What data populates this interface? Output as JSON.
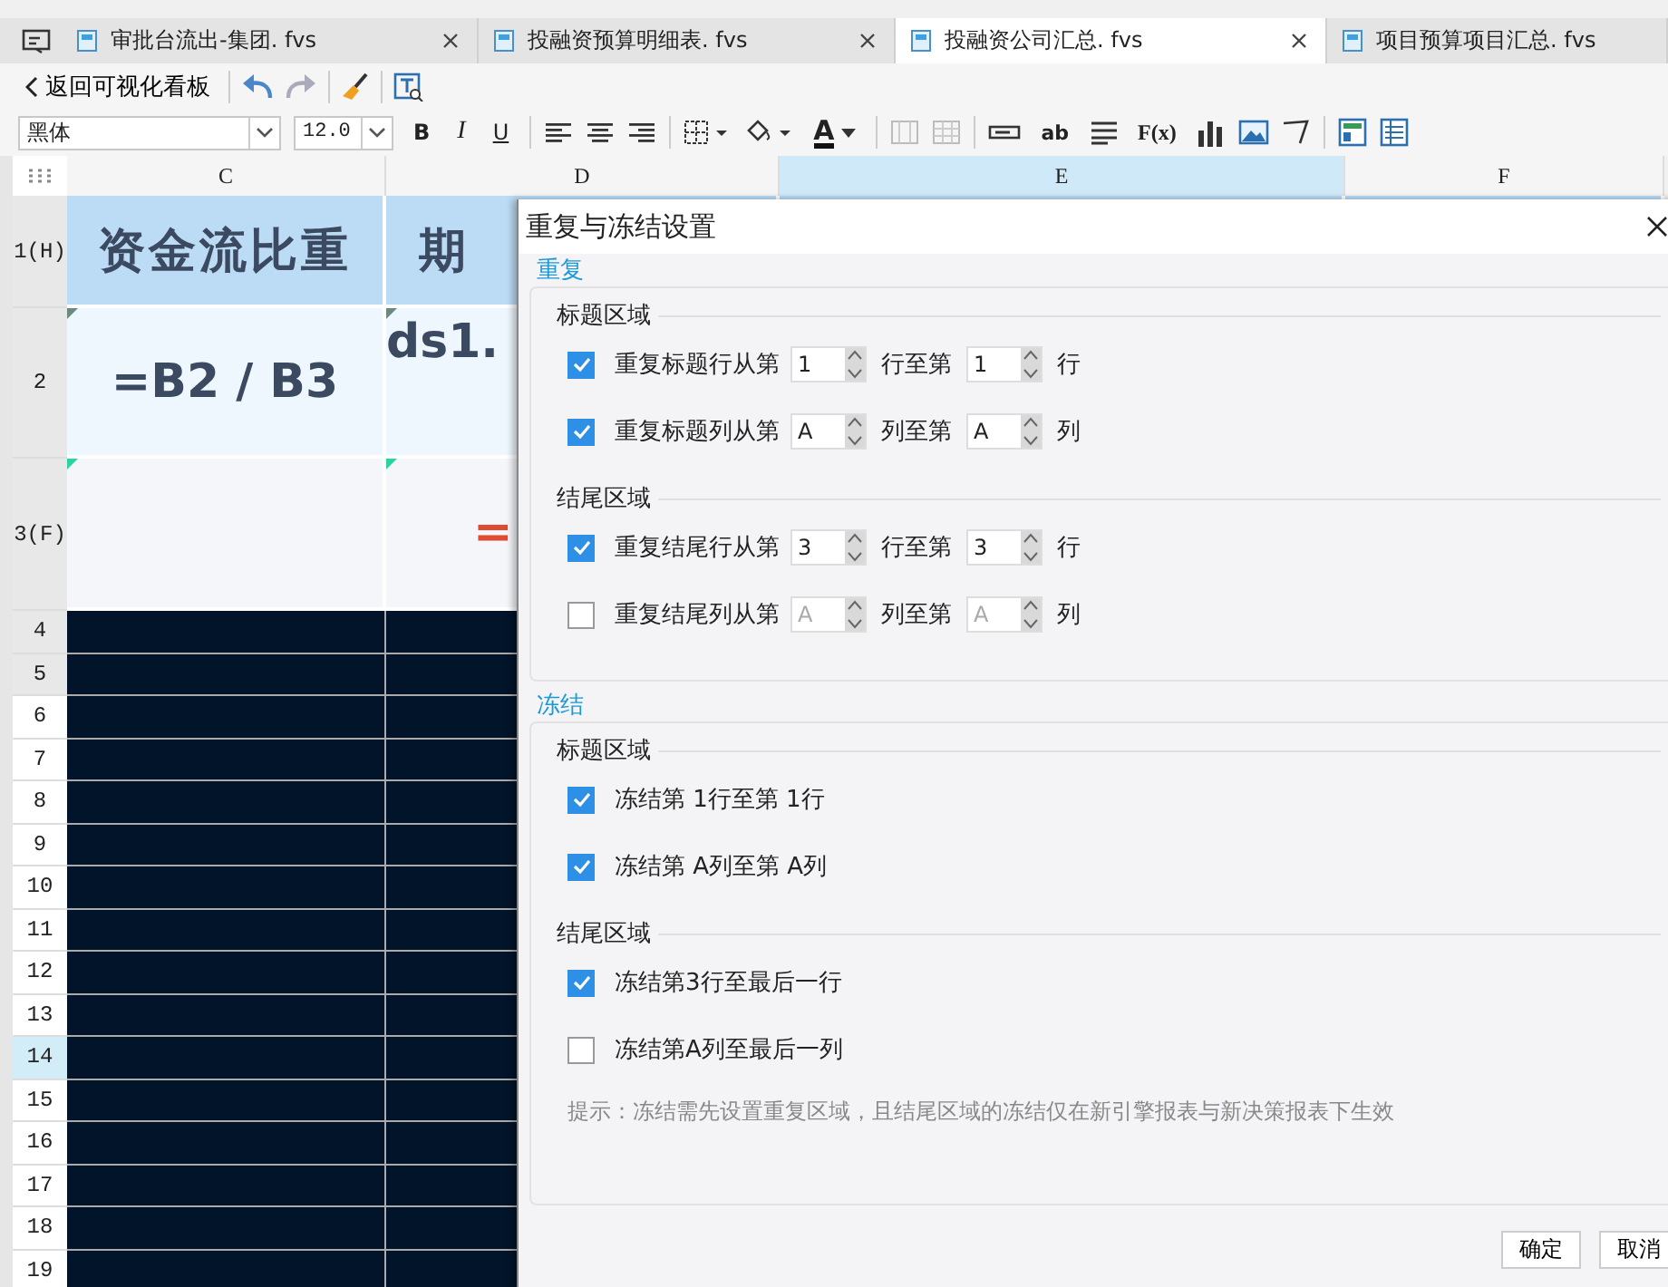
{
  "tabs": [
    {
      "label": "审批台流出-集团. fvs",
      "selected": false,
      "closable": true
    },
    {
      "label": "投融资预算明细表. fvs",
      "selected": false,
      "closable": true
    },
    {
      "label": "投融资公司汇总. fvs",
      "selected": true,
      "closable": true
    },
    {
      "label": "项目预算项目汇总. fvs",
      "selected": false,
      "closable": false
    }
  ],
  "toolbar": {
    "back": "返回可视化看板"
  },
  "format_bar": {
    "font": "黑体",
    "size": "12.0",
    "bold": "B",
    "italic": "I",
    "underline": "U",
    "font_color": "A",
    "text_widget": "ab",
    "formula": "F(x)"
  },
  "columns": [
    {
      "label": "C",
      "selected": false
    },
    {
      "label": "D",
      "selected": false
    },
    {
      "label": "E",
      "selected": true
    },
    {
      "label": "F",
      "selected": false
    }
  ],
  "rows": [
    {
      "label": "1(H)",
      "kind": "header",
      "frozen": true,
      "selected": false,
      "cells": [
        "资金流比重",
        "期"
      ]
    },
    {
      "label": "2",
      "kind": "formula",
      "frozen": true,
      "selected": false,
      "cells": [
        "=B2 / B3",
        "ds1."
      ]
    },
    {
      "label": "3(F)",
      "kind": "footer",
      "frozen": true,
      "selected": false,
      "cells": [
        "",
        "="
      ]
    },
    {
      "label": "4",
      "kind": "empty",
      "frozen": true,
      "selected": false
    },
    {
      "label": "5",
      "kind": "empty",
      "frozen": true,
      "selected": false
    },
    {
      "label": "6",
      "kind": "empty",
      "frozen": false,
      "selected": false
    },
    {
      "label": "7",
      "kind": "empty",
      "frozen": false,
      "selected": false
    },
    {
      "label": "8",
      "kind": "empty",
      "frozen": false,
      "selected": false
    },
    {
      "label": "9",
      "kind": "empty",
      "frozen": false,
      "selected": false
    },
    {
      "label": "10",
      "kind": "empty",
      "frozen": false,
      "selected": false
    },
    {
      "label": "11",
      "kind": "empty",
      "frozen": false,
      "selected": false
    },
    {
      "label": "12",
      "kind": "empty",
      "frozen": false,
      "selected": false
    },
    {
      "label": "13",
      "kind": "empty",
      "frozen": false,
      "selected": false
    },
    {
      "label": "14",
      "kind": "empty",
      "frozen": false,
      "selected": true
    },
    {
      "label": "15",
      "kind": "empty",
      "frozen": false,
      "selected": false
    },
    {
      "label": "16",
      "kind": "empty",
      "frozen": false,
      "selected": false
    },
    {
      "label": "17",
      "kind": "empty",
      "frozen": false,
      "selected": false
    },
    {
      "label": "18",
      "kind": "empty",
      "frozen": false,
      "selected": false
    },
    {
      "label": "19",
      "kind": "empty",
      "frozen": false,
      "selected": false
    }
  ],
  "dialog": {
    "title": "重复与冻结设置",
    "sections": [
      {
        "title": "重复",
        "groups": [
          {
            "title": "标题区域",
            "rows": [
              {
                "kind": "range",
                "checked": true,
                "disabled": false,
                "label": "重复标题行从第",
                "from": "1",
                "middle": "行至第",
                "to": "1",
                "suffix": "行"
              },
              {
                "kind": "range",
                "checked": true,
                "disabled": false,
                "label": "重复标题列从第",
                "from": "A",
                "middle": "列至第",
                "to": "A",
                "suffix": "列"
              }
            ]
          },
          {
            "title": "结尾区域",
            "rows": [
              {
                "kind": "range",
                "checked": true,
                "disabled": false,
                "label": "重复结尾行从第",
                "from": "3",
                "middle": "行至第",
                "to": "3",
                "suffix": "行"
              },
              {
                "kind": "range",
                "checked": false,
                "disabled": true,
                "label": "重复结尾列从第",
                "from": "A",
                "middle": "列至第",
                "to": "A",
                "suffix": "列"
              }
            ]
          }
        ]
      },
      {
        "title": "冻结",
        "groups": [
          {
            "title": "标题区域",
            "rows": [
              {
                "kind": "simple",
                "checked": true,
                "label": "冻结第 1行至第 1行"
              },
              {
                "kind": "simple",
                "checked": true,
                "label": "冻结第 A列至第 A列"
              }
            ]
          },
          {
            "title": "结尾区域",
            "rows": [
              {
                "kind": "simple",
                "checked": true,
                "label": "冻结第3行至最后一行"
              },
              {
                "kind": "simple",
                "checked": false,
                "label": "冻结第A列至最后一列"
              }
            ]
          }
        ],
        "hint": "提示：冻结需先设置重复区域，且结尾区域的冻结仅在新引擎报表与新决策报表下生效"
      }
    ],
    "buttons": [
      "确定",
      "取消"
    ]
  }
}
